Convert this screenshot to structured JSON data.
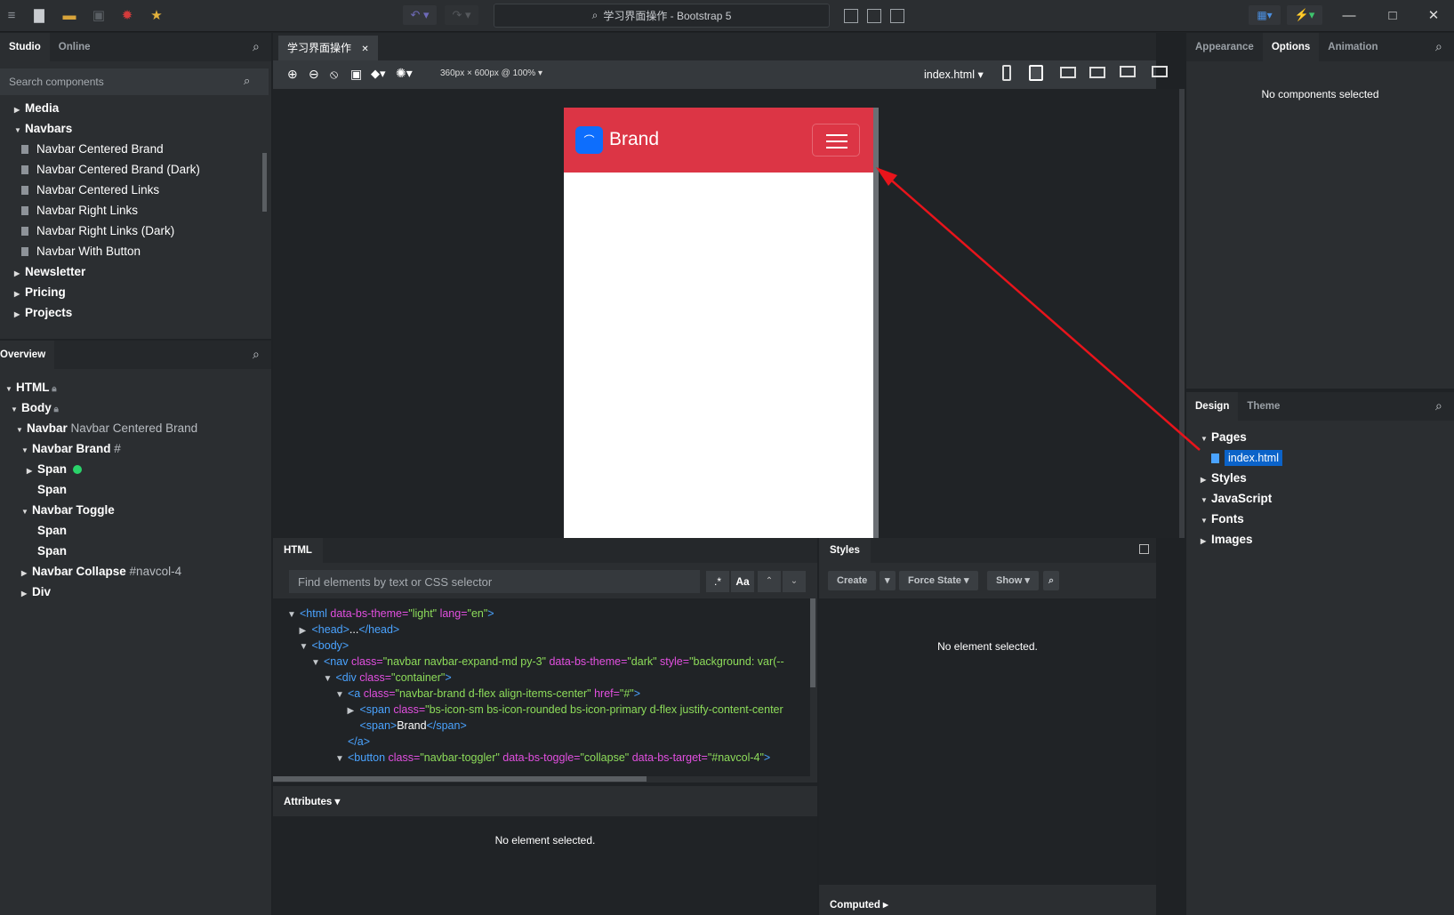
{
  "window": {
    "title": "学习界面操作 - Bootstrap 5"
  },
  "left_top": {
    "tabs": [
      "Studio",
      "Online"
    ],
    "search_placeholder": "Search components"
  },
  "components": [
    {
      "label": "Media",
      "level": 0,
      "expanded": false
    },
    {
      "label": "Navbars",
      "level": 0,
      "expanded": true
    },
    {
      "label": "Navbar Centered Brand",
      "level": 1
    },
    {
      "label": "Navbar Centered Brand (Dark)",
      "level": 1
    },
    {
      "label": "Navbar Centered Links",
      "level": 1
    },
    {
      "label": "Navbar Right Links",
      "level": 1
    },
    {
      "label": "Navbar Right Links (Dark)",
      "level": 1
    },
    {
      "label": "Navbar With Button",
      "level": 1
    },
    {
      "label": "Newsletter",
      "level": 0,
      "expanded": false
    },
    {
      "label": "Pricing",
      "level": 0,
      "expanded": false
    },
    {
      "label": "Projects",
      "level": 0,
      "expanded": false
    }
  ],
  "overview": {
    "tab": "Overview",
    "nodes": [
      {
        "label": "HTML",
        "extra": "",
        "indent": 0,
        "caret": "▼",
        "lock": true
      },
      {
        "label": "Body",
        "extra": "",
        "indent": 1,
        "caret": "▼",
        "lock": true
      },
      {
        "label": "Navbar",
        "extra": "Navbar Centered Brand",
        "indent": 2,
        "caret": "▼"
      },
      {
        "label": "Navbar Brand",
        "extra": "#",
        "indent": 3,
        "caret": "▼"
      },
      {
        "label": "Span",
        "extra": "",
        "indent": 4,
        "caret": "▶",
        "dot": true
      },
      {
        "label": "Span",
        "extra": "",
        "indent": 4,
        "caret": ""
      },
      {
        "label": "Navbar Toggle",
        "extra": "",
        "indent": 3,
        "caret": "▼"
      },
      {
        "label": "Span",
        "extra": "",
        "indent": 4,
        "caret": ""
      },
      {
        "label": "Span",
        "extra": "",
        "indent": 4,
        "caret": ""
      },
      {
        "label": "Navbar Collapse",
        "extra": "#navcol-4",
        "indent": 3,
        "caret": "▶"
      },
      {
        "label": "Div",
        "extra": "",
        "indent": 3,
        "caret": "▶"
      }
    ]
  },
  "editor": {
    "doc_tab": "学习界面操作",
    "size_readout": "360px × 600px @ 100%",
    "page_select": "index.html",
    "preview": {
      "brand_text": "Brand",
      "navbar_color": "#dc3545",
      "icon_color": "#0d6efd"
    }
  },
  "html_panel": {
    "title": "HTML",
    "find_placeholder": "Find elements by text or CSS selector",
    "regex_btn": ".*",
    "case_btn": "Aa",
    "lines": [
      {
        "caret": "▼",
        "indent": 0,
        "parts": [
          [
            "tag",
            "<html "
          ],
          [
            "attr",
            "data-bs-theme="
          ],
          [
            "val",
            "\"light\""
          ],
          [
            "attr",
            " lang="
          ],
          [
            "val",
            "\"en\""
          ],
          [
            "tag",
            ">"
          ]
        ]
      },
      {
        "caret": "▶",
        "indent": 1,
        "parts": [
          [
            "tag",
            "<head>"
          ],
          [
            "txt",
            "..."
          ],
          [
            "tag",
            "</head>"
          ]
        ]
      },
      {
        "caret": "▼",
        "indent": 1,
        "parts": [
          [
            "tag",
            "<body>"
          ]
        ]
      },
      {
        "caret": "▼",
        "indent": 2,
        "parts": [
          [
            "tag",
            "<nav "
          ],
          [
            "attr",
            "class="
          ],
          [
            "val",
            "\"navbar navbar-expand-md py-3\""
          ],
          [
            "attr",
            " data-bs-theme="
          ],
          [
            "val",
            "\"dark\""
          ],
          [
            "attr",
            " style="
          ],
          [
            "val",
            "\"background: var(--"
          ]
        ]
      },
      {
        "caret": "▼",
        "indent": 3,
        "parts": [
          [
            "tag",
            "<div "
          ],
          [
            "attr",
            "class="
          ],
          [
            "val",
            "\"container\""
          ],
          [
            "tag",
            ">"
          ]
        ]
      },
      {
        "caret": "▼",
        "indent": 4,
        "parts": [
          [
            "tag",
            "<a "
          ],
          [
            "attr",
            "class="
          ],
          [
            "val",
            "\"navbar-brand d-flex align-items-center\""
          ],
          [
            "attr",
            " href="
          ],
          [
            "val",
            "\"#\""
          ],
          [
            "tag",
            ">"
          ]
        ]
      },
      {
        "caret": "▶",
        "indent": 5,
        "parts": [
          [
            "tag",
            "<span "
          ],
          [
            "attr",
            "class="
          ],
          [
            "val",
            "\"bs-icon-sm bs-icon-rounded bs-icon-primary d-flex justify-content-center"
          ]
        ]
      },
      {
        "caret": "",
        "indent": 5,
        "parts": [
          [
            "tag",
            "<span>"
          ],
          [
            "txt",
            "Brand"
          ],
          [
            "tag",
            "</span>"
          ]
        ]
      },
      {
        "caret": "",
        "indent": 4,
        "parts": [
          [
            "tag",
            "</a>"
          ]
        ]
      },
      {
        "caret": "▼",
        "indent": 4,
        "parts": [
          [
            "tag",
            "<button "
          ],
          [
            "attr",
            "class="
          ],
          [
            "val",
            "\"navbar-toggler\""
          ],
          [
            "attr",
            " data-bs-toggle="
          ],
          [
            "val",
            "\"collapse\""
          ],
          [
            "attr",
            " data-bs-target="
          ],
          [
            "val",
            "\"#navcol-4\""
          ],
          [
            "tag",
            ">"
          ]
        ]
      }
    ]
  },
  "attributes": {
    "title": "Attributes",
    "empty": "No element selected."
  },
  "styles": {
    "title": "Styles",
    "create": "Create",
    "force_state": "Force State",
    "show": "Show",
    "empty": "No element selected.",
    "computed": "Computed"
  },
  "right_top": {
    "tabs": [
      "Appearance",
      "Options",
      "Animation"
    ],
    "active": "Options",
    "empty": "No components selected"
  },
  "design": {
    "tabs": [
      "Design",
      "Theme"
    ],
    "items": [
      {
        "label": "Pages",
        "caret": "▼"
      },
      {
        "label": "index.html",
        "caret": "",
        "selected": true
      },
      {
        "label": "Styles",
        "caret": "▶"
      },
      {
        "label": "JavaScript",
        "caret": "▼"
      },
      {
        "label": "Fonts",
        "caret": "▼"
      },
      {
        "label": "Images",
        "caret": "▶"
      }
    ]
  },
  "annotation_color": "#e8141b"
}
